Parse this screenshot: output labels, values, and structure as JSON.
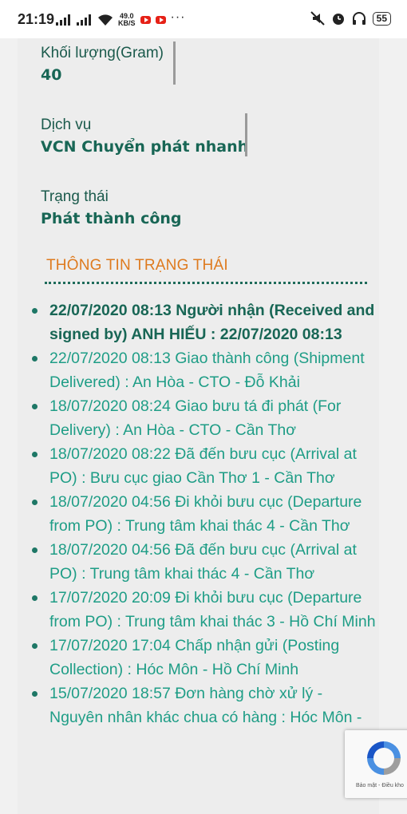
{
  "status_bar": {
    "time": "21:19",
    "net_speed_value": "49.0",
    "net_speed_unit": "KB/S",
    "more": "···",
    "battery": "55"
  },
  "fields": {
    "weight_label": "Khối lượng(Gram)",
    "weight_value": "40",
    "service_label": "Dịch vụ",
    "service_value": "VCN Chuyển phát nhanh",
    "status_label": "Trạng thái",
    "status_value": "Phát thành công"
  },
  "section_title": "THÔNG TIN TRẠNG THÁI",
  "events": [
    "22/07/2020 08:13 Người nhận (Received and signed by) ANH HIẾU : 22/07/2020 08:13",
    "22/07/2020 08:13 Giao thành công (Shipment Delivered) : An Hòa - CTO - Đỗ Khải",
    "18/07/2020 08:24 Giao bưu tá đi phát (For Delivery) : An Hòa - CTO - Cần Thơ",
    "18/07/2020 08:22 Đã đến bưu cục (Arrival at PO) : Bưu cục giao Cần Thơ 1 - Cần Thơ",
    "18/07/2020 04:56 Đi khỏi bưu cục (Departure from PO) : Trung tâm khai thác 4 - Cần Thơ",
    "18/07/2020 04:56 Đã đến bưu cục (Arrival at PO) : Trung tâm khai thác 4 - Cần Thơ",
    "17/07/2020 20:09 Đi khỏi bưu cục (Departure from PO) : Trung tâm khai thác 3 - Hồ Chí Minh",
    "17/07/2020 17:04 Chấp nhận gửi (Posting Collection) : Hóc Môn - Hồ Chí Minh",
    "15/07/2020 18:57 Đơn hàng chờ xử lý - Nguyên nhân khác chua có hàng : Hóc Môn -"
  ],
  "recaptcha": {
    "privacy": "Bảo mật",
    "separator": " - ",
    "terms": "Điều kho"
  }
}
